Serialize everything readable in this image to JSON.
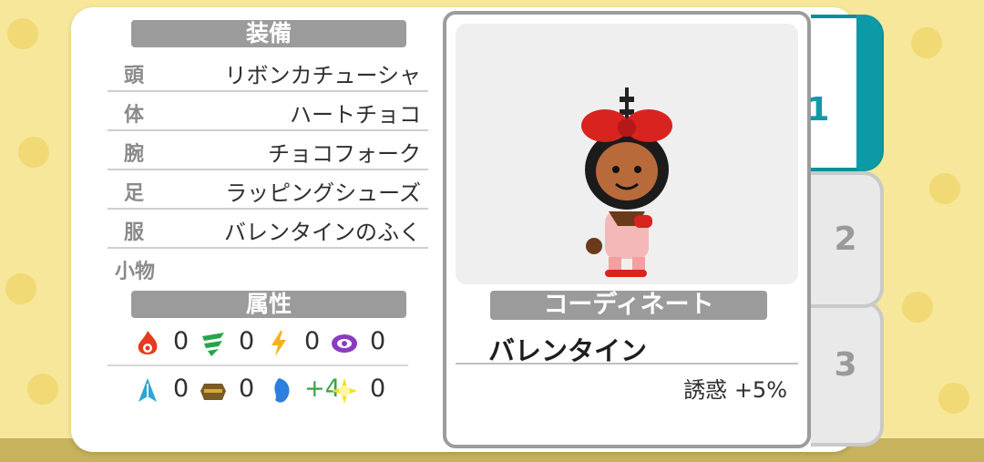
{
  "equipment": {
    "header": "装備",
    "slots": [
      {
        "slot": "頭",
        "item": "リボンカチューシャ"
      },
      {
        "slot": "体",
        "item": "ハートチョコ"
      },
      {
        "slot": "腕",
        "item": "チョコフォーク"
      },
      {
        "slot": "足",
        "item": "ラッピングシューズ"
      },
      {
        "slot": "服",
        "item": "バレンタインのふく"
      }
    ],
    "accessory_label": "小物"
  },
  "attributes": {
    "header": "属性",
    "row1": [
      {
        "icon": "fire-icon",
        "value": "0",
        "color": "#e43b1d"
      },
      {
        "icon": "wind-icon",
        "value": "0",
        "color": "#27a44a"
      },
      {
        "icon": "lightning-icon",
        "value": "0",
        "color": "#f3b21a"
      },
      {
        "icon": "dark-icon",
        "value": "0",
        "color": "#8a3bbf"
      }
    ],
    "row2": [
      {
        "icon": "ice-icon",
        "value": "0",
        "color": "#2aa6d8"
      },
      {
        "icon": "earth-icon",
        "value": "0",
        "color": "#7a5a25"
      },
      {
        "icon": "water-icon",
        "value": "+4",
        "color": "#2a7fe0"
      },
      {
        "icon": "light-icon",
        "value": "0",
        "color": "#f2e028"
      }
    ]
  },
  "coordinate": {
    "header": "コーディネート",
    "name": "バレンタイン",
    "bonus": "誘惑 +5%"
  },
  "tabs": [
    "1",
    "2",
    "3"
  ],
  "colors": {
    "accent": "#0b9aa6",
    "header_bg": "#9b9b9b",
    "background": "#f6e79a"
  }
}
